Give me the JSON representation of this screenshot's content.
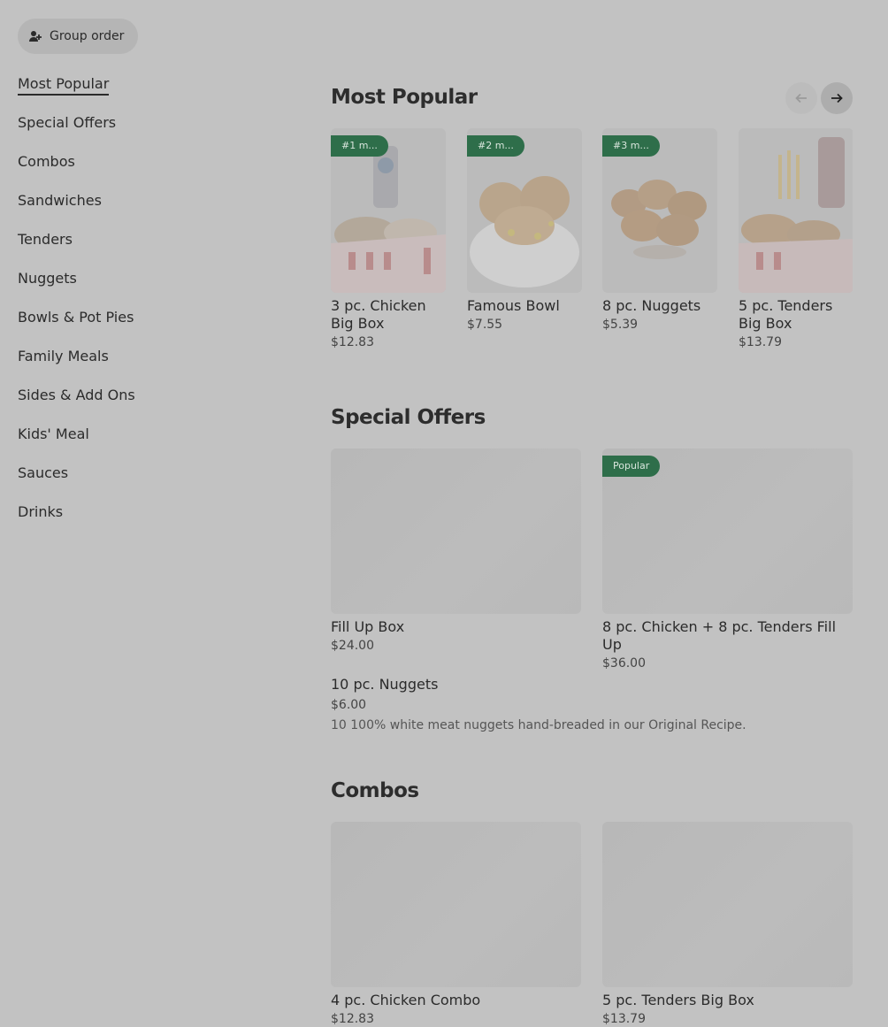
{
  "group_order": {
    "label": "Group order"
  },
  "sidebar": {
    "items": [
      {
        "label": "Most Popular"
      },
      {
        "label": "Special Offers"
      },
      {
        "label": "Combos"
      },
      {
        "label": "Sandwiches"
      },
      {
        "label": "Tenders"
      },
      {
        "label": "Nuggets"
      },
      {
        "label": "Bowls & Pot Pies"
      },
      {
        "label": "Family Meals"
      },
      {
        "label": "Sides & Add Ons"
      },
      {
        "label": "Kids' Meal"
      },
      {
        "label": "Sauces"
      },
      {
        "label": "Drinks"
      }
    ]
  },
  "most_popular": {
    "title": "Most Popular",
    "items": [
      {
        "badge": "#1 m...",
        "name": "3 pc. Chicken Big Box",
        "price": "$12.83"
      },
      {
        "badge": "#2 m...",
        "name": "Famous Bowl",
        "price": "$7.55"
      },
      {
        "badge": "#3 m...",
        "name": "8 pc. Nuggets",
        "price": "$5.39"
      },
      {
        "badge": "",
        "name": "5 pc. Tenders Big Box",
        "price": "$13.79"
      }
    ]
  },
  "special_offers": {
    "title": "Special Offers",
    "items": [
      {
        "name": "Fill Up Box",
        "price": "$24.00",
        "badge": ""
      },
      {
        "name": "8 pc. Chicken + 8 pc. Tenders Fill Up",
        "price": "$36.00",
        "badge": "Popular"
      }
    ],
    "text_item": {
      "name": "10 pc. Nuggets",
      "price": "$6.00",
      "description": "10 100% white meat nuggets hand-breaded in our Original Recipe."
    }
  },
  "combos": {
    "title": "Combos",
    "items": [
      {
        "name": "4 pc. Chicken Combo",
        "price": "$12.83"
      },
      {
        "name": "5 pc. Tenders Big Box",
        "price": "$13.79"
      }
    ]
  },
  "colors": {
    "badge_green": "#2e6e4a",
    "overlay_gray": "#c2c2c2"
  }
}
